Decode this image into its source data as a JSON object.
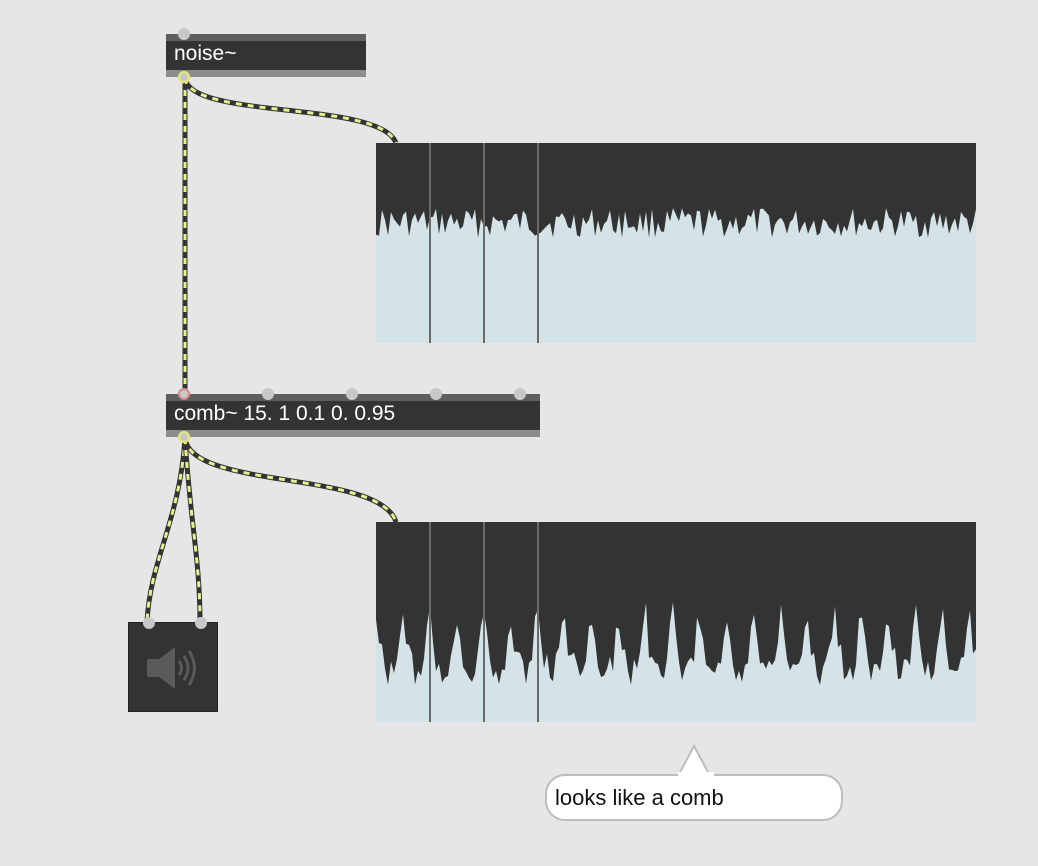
{
  "objects": {
    "noise": {
      "label": "noise~"
    },
    "comb": {
      "label": "comb~ 15. 1 0.1 0. 0.95"
    }
  },
  "scopes": {
    "noise_scope": {
      "fill": "#d3e3e8",
      "background": "#333333"
    },
    "comb_scope": {
      "fill": "#d3e3e8",
      "background": "#333333"
    }
  },
  "dac": {
    "icon": "speaker-icon"
  },
  "comment": {
    "text": "looks like a comb"
  },
  "colors": {
    "canvas": "#e6e6e6",
    "object_bg": "#333333",
    "cable_dash": "#e6f08c",
    "cable_base": "#333333"
  }
}
